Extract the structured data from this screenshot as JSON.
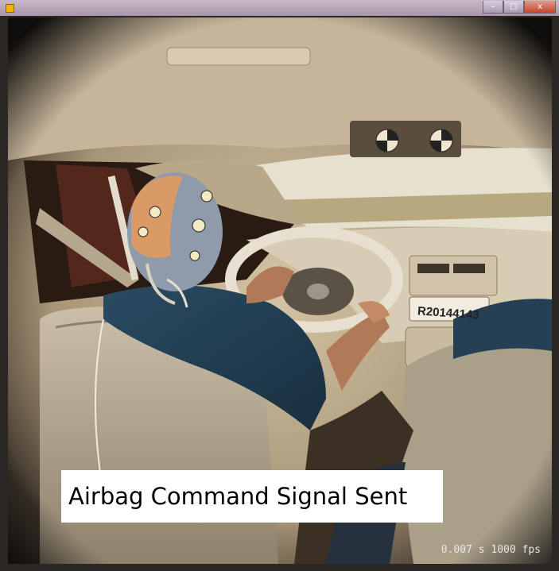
{
  "window": {
    "minimize_glyph": "–",
    "maximize_glyph": "□",
    "close_glyph": "x"
  },
  "video": {
    "caption": "Airbag Command Signal Sent",
    "time": "0.007 s",
    "fps": "1000 fps",
    "timestamp": "0.007 s 1000 fps",
    "plate_label": "R20144143"
  },
  "icons": {
    "app": "app-icon",
    "minimize": "minimize-icon",
    "maximize": "maximize-icon",
    "close": "close-icon"
  }
}
